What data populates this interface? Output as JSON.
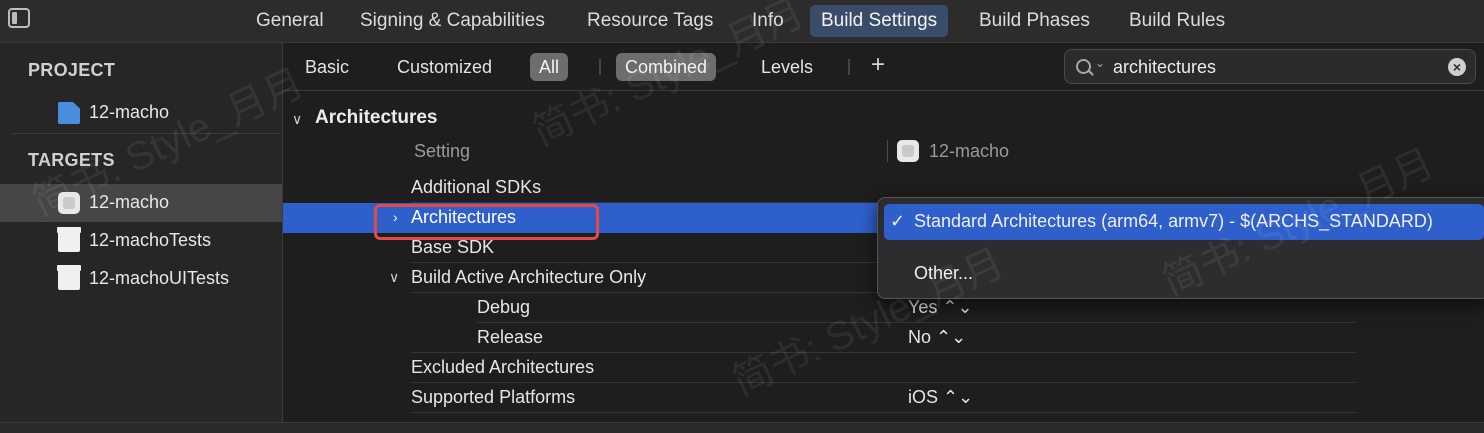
{
  "top_tabs": [
    "General",
    "Signing & Capabilities",
    "Resource Tags",
    "Info",
    "Build Settings",
    "Build Phases",
    "Build Rules"
  ],
  "sidebar": {
    "project_header": "PROJECT",
    "project_item": "12-macho",
    "targets_header": "TARGETS",
    "targets": [
      "12-macho",
      "12-machoTests",
      "12-machoUITests"
    ]
  },
  "filter_bar": {
    "basic": "Basic",
    "customized": "Customized",
    "all": "All",
    "combined": "Combined",
    "levels": "Levels",
    "add": "+"
  },
  "search": {
    "value": "architectures"
  },
  "section": {
    "title": "Architectures",
    "setting_header": "Setting",
    "target_header": "12-macho"
  },
  "rows": {
    "additional_sdks": "Additional SDKs",
    "architectures": "Architectures",
    "base_sdk": "Base SDK",
    "build_active_arch_only": "Build Active Architecture Only",
    "debug": "Debug",
    "debug_value": "Yes ⌃⌄",
    "release": "Release",
    "release_value": "No ⌃⌄",
    "excluded_archs": "Excluded Architectures",
    "supported_platforms": "Supported Platforms",
    "supported_platforms_value": "iOS ⌃⌄"
  },
  "popup": {
    "checkmark": "✓",
    "selected_option": "Standard Architectures (arm64, armv7)  -  $(ARCHS_STANDARD)",
    "other_option": "Other..."
  },
  "watermark_text": "简书: Style_月月",
  "colors": {
    "selection": "#2f5fca",
    "active_tab": "#3a4c6a",
    "annotation": "#e24a4a"
  }
}
